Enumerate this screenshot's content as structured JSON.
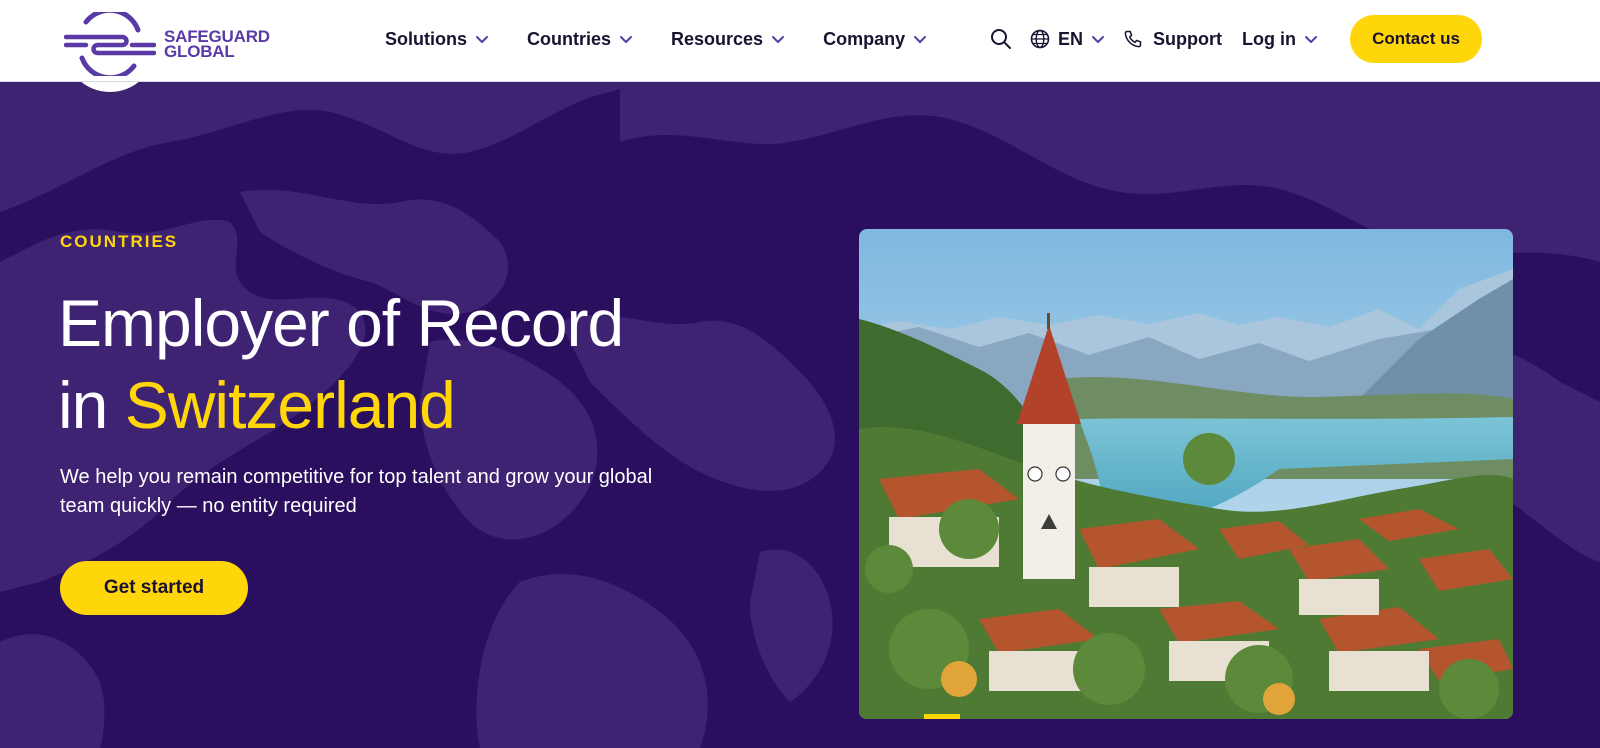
{
  "brand": {
    "line1": "SAFEGUARD",
    "line2": "GLOBAL",
    "logo_icon": "safeguard-logo-icon",
    "color": "#5a3aa6"
  },
  "nav": {
    "items": [
      {
        "label": "Solutions"
      },
      {
        "label": "Countries"
      },
      {
        "label": "Resources"
      },
      {
        "label": "Company"
      }
    ]
  },
  "tools": {
    "search_icon": "search-icon",
    "language": "EN",
    "language_icon": "globe-icon",
    "support": "Support",
    "support_icon": "phone-icon",
    "login": "Log in",
    "contact": "Contact us"
  },
  "hero": {
    "eyebrow": "COUNTRIES",
    "title_line1": "Employer of Record",
    "title_prefix": "in ",
    "title_highlight": "Switzerland",
    "subtitle": "We help you remain competitive for top talent and grow your global team quickly — no entity required",
    "cta": "Get started",
    "image": "swiss-lake-town-photo"
  },
  "colors": {
    "accent": "#ffd60a",
    "hero_bg": "#2a0f5e",
    "map_land": "#3f2373",
    "text_dark": "#1a1230"
  }
}
